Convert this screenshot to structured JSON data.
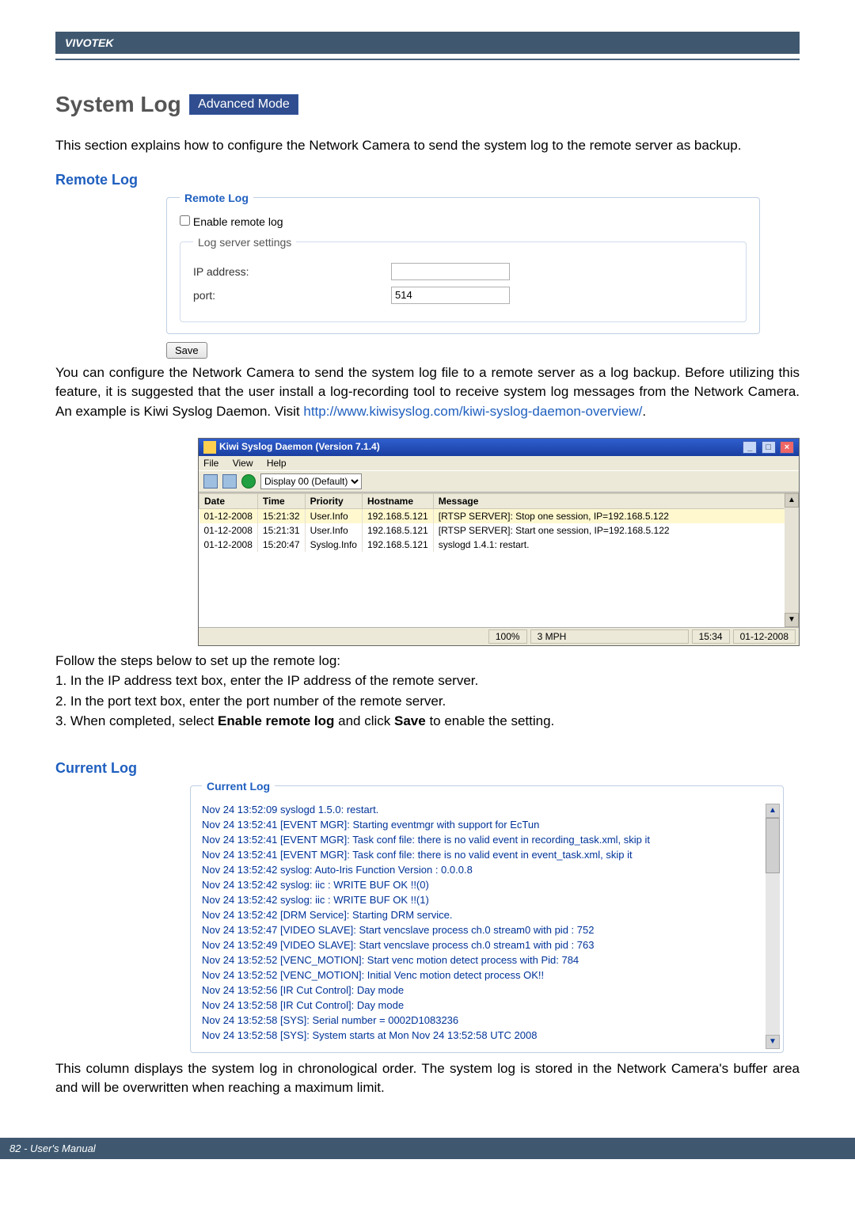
{
  "header": {
    "brand": "VIVOTEK"
  },
  "title": {
    "text": "System Log",
    "badge": "Advanced Mode"
  },
  "intro": "This section explains how to configure the Network Camera to send the system log to the remote server as backup.",
  "remotelog": {
    "section_label": "Remote Log",
    "fieldset_legend": "Remote Log",
    "enable_label": "Enable remote log",
    "settings_legend": "Log server settings",
    "ip_label": "IP address:",
    "ip_value": "",
    "port_label": "port:",
    "port_value": "514",
    "save_label": "Save"
  },
  "para2": {
    "t1": "You can configure the Network Camera to send the system log file to a remote server as a log backup. Before utilizing this feature, it is suggested that the user install a log-recording tool to receive system log messages from the Network Camera. An example is Kiwi Syslog Daemon. Visit ",
    "link": "http://www.kiwisyslog.com/kiwi-syslog-daemon-overview/",
    "t2": "."
  },
  "kiwi": {
    "title": "Kiwi Syslog Daemon (Version 7.1.4)",
    "menu": {
      "file": "File",
      "view": "View",
      "help": "Help"
    },
    "display_sel": "Display 00 (Default)",
    "headers": {
      "date": "Date",
      "time": "Time",
      "priority": "Priority",
      "hostname": "Hostname",
      "message": "Message"
    },
    "rows": [
      {
        "date": "01-12-2008",
        "time": "15:21:32",
        "priority": "User.Info",
        "hostname": "192.168.5.121",
        "message": "[RTSP SERVER]: Stop one session, IP=192.168.5.122"
      },
      {
        "date": "01-12-2008",
        "time": "15:21:31",
        "priority": "User.Info",
        "hostname": "192.168.5.121",
        "message": "[RTSP SERVER]: Start one session, IP=192.168.5.122"
      },
      {
        "date": "01-12-2008",
        "time": "15:20:47",
        "priority": "Syslog.Info",
        "hostname": "192.168.5.121",
        "message": "syslogd 1.4.1: restart."
      }
    ],
    "status": {
      "pct": "100%",
      "mph": "3 MPH",
      "time": "15:34",
      "date": "01-12-2008"
    }
  },
  "steps": {
    "lead": "Follow the steps below to set up the remote log:",
    "s1": "1. In the IP address text box, enter the IP address of the remote server.",
    "s2": "2. In the port text box, enter the port number of the remote server.",
    "s3a": "3. When completed, select ",
    "s3b": "Enable remote log",
    "s3c": " and click ",
    "s3d": "Save",
    "s3e": " to enable the setting."
  },
  "currentlog": {
    "section_label": "Current Log",
    "legend": "Current Log",
    "lines": [
      "Nov 24 13:52:09 syslogd 1.5.0: restart.",
      "Nov 24 13:52:41 [EVENT MGR]: Starting eventmgr with support for EcTun",
      "Nov 24 13:52:41 [EVENT MGR]: Task conf file: there is no valid event in recording_task.xml, skip it",
      "Nov 24 13:52:41 [EVENT MGR]: Task conf file: there is no valid event in event_task.xml, skip it",
      "Nov 24 13:52:42 syslog: Auto-Iris Function Version : 0.0.0.8",
      "Nov 24 13:52:42 syslog: iic : WRITE BUF OK !!(0)",
      "Nov 24 13:52:42 syslog: iic : WRITE BUF OK !!(1)",
      "Nov 24 13:52:42 [DRM Service]: Starting DRM service.",
      "Nov 24 13:52:47 [VIDEO SLAVE]: Start vencslave process ch.0 stream0 with pid : 752",
      "Nov 24 13:52:49 [VIDEO SLAVE]: Start vencslave process ch.0 stream1 with pid : 763",
      "Nov 24 13:52:52 [VENC_MOTION]: Start venc motion detect process with Pid: 784",
      "Nov 24 13:52:52 [VENC_MOTION]: Initial Venc motion detect process OK!!",
      "Nov 24 13:52:56 [IR Cut Control]: Day mode",
      "Nov 24 13:52:58 [IR Cut Control]: Day mode",
      "Nov 24 13:52:58 [SYS]: Serial number = 0002D1083236",
      "Nov 24 13:52:58 [SYS]: System starts at Mon Nov 24 13:52:58 UTC 2008"
    ]
  },
  "closing": "This column displays the system log in chronological order. The system log is stored in the Network Camera's buffer area and will be overwritten when reaching a maximum limit.",
  "footer": {
    "page": "82 - User's Manual"
  }
}
